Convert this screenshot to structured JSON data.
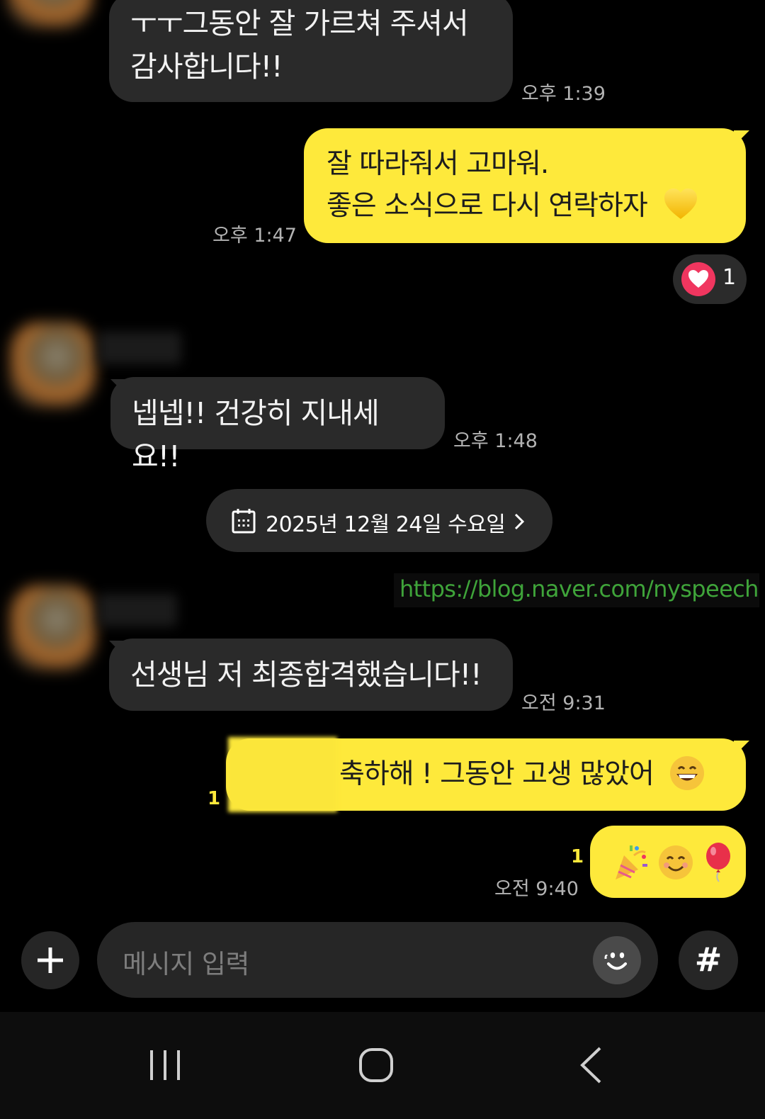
{
  "messages": [
    {
      "id": "m1",
      "side": "in",
      "lines": [
        "ㅜㅜ그동안 잘 가르쳐 주셔서",
        "감사합니다!!"
      ],
      "time": "오후 1:39"
    },
    {
      "id": "m2",
      "side": "out",
      "lines": [
        "잘 따라줘서 고마워.",
        "좋은 소식으로 다시 연락하자"
      ],
      "emoji": "yellow-heart",
      "time": "오후 1:47",
      "reaction": {
        "icon": "heart-icon",
        "count": "1"
      }
    },
    {
      "id": "m3",
      "side": "in",
      "lines": [
        "넵넵!! 건강히 지내세요!!"
      ],
      "time": "오후 1:48"
    },
    {
      "id": "m4",
      "side": "in",
      "lines": [
        "선생님 저 최종합격했습니다!!"
      ],
      "time": "오전 9:31"
    },
    {
      "id": "m5",
      "side": "out",
      "lines": [
        "축하해 ! 그동안 고생 많았어"
      ],
      "emoji": "grinning-face",
      "unread": "1"
    },
    {
      "id": "m6",
      "side": "out",
      "emojis": [
        "party-popper",
        "smiling-face",
        "balloon"
      ],
      "unread": "1",
      "time": "오전 9:40"
    }
  ],
  "date_divider": "2025년 12월 24일 수요일",
  "watermark": "https://blog.naver.com/nyspeech",
  "composer": {
    "placeholder": "메시지 입력",
    "hash_label": "#"
  },
  "colors": {
    "background": "#000000",
    "incoming_bubble": "#2a2a2a",
    "outgoing_bubble": "#fee93b",
    "time_text": "#b3b3b3",
    "watermark": "#3fa43a"
  }
}
